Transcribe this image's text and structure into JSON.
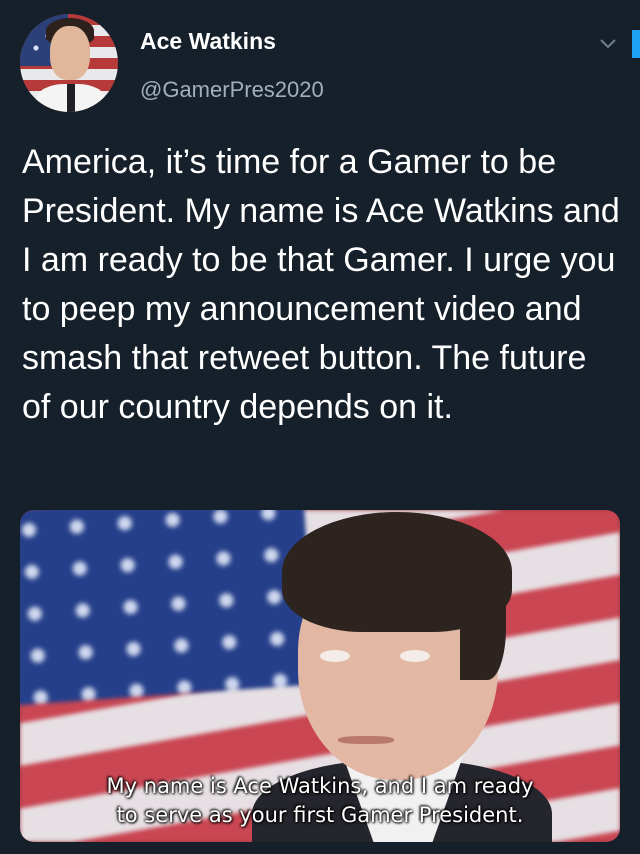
{
  "author": {
    "display_name": "Ace Watkins",
    "handle": "@GamerPres2020",
    "avatar_icon": "profile-photo"
  },
  "tweet": {
    "text": "America, it’s time for a Gamer to be President. My name is Ace Watkins and I am ready to be that Gamer. I urge you to peep my announcement video and smash that retweet button. The future of our country depends on it."
  },
  "media": {
    "caption_line1": "My name is Ace Watkins, and I am ready",
    "caption_line2": "to serve as your first Gamer President."
  },
  "icons": {
    "more": "chevron-down-icon"
  },
  "colors": {
    "background": "#15202b",
    "secondary_text": "#a2b0bd",
    "accent": "#1da1f2"
  }
}
